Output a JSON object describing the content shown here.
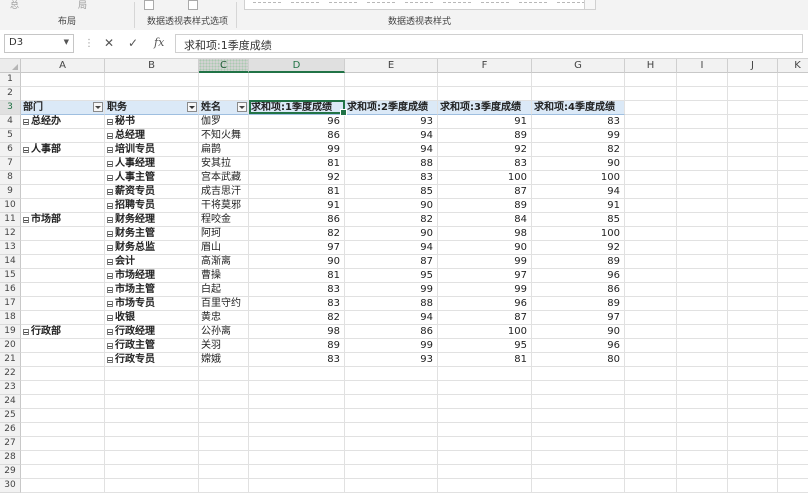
{
  "ribbon": {
    "fragment_left": "总",
    "fragment_mid": "局",
    "group_layout": "布局",
    "group_style_options": "数据透视表样式选项",
    "group_styles": "数据透视表样式"
  },
  "formula_bar": {
    "name_box": "D3",
    "cancel_icon": "✕",
    "confirm_icon": "✓",
    "function_icon": "fx",
    "formula": "求和项:1季度成绩"
  },
  "grid": {
    "selected_cell": "D3",
    "columns": [
      "A",
      "B",
      "C",
      "D",
      "E",
      "F",
      "G",
      "H",
      "I",
      "J",
      "K"
    ],
    "rows": [
      "1",
      "2",
      "3",
      "4",
      "5",
      "6",
      "7",
      "8",
      "9",
      "10",
      "11",
      "12",
      "13",
      "14",
      "15",
      "16",
      "17",
      "18",
      "19",
      "20",
      "21",
      "22",
      "23",
      "24",
      "25",
      "26",
      "27",
      "28",
      "29",
      "30"
    ],
    "header_row": {
      "dept": "部门",
      "job": "职务",
      "name": "姓名",
      "q1": "求和项:1季度成绩",
      "q2": "求和项:2季度成绩",
      "q3": "求和项:3季度成绩",
      "q4": "求和项:4季度成绩"
    },
    "data": [
      {
        "dept": "总经办",
        "job": "秘书",
        "name": "伽罗",
        "q1": "96",
        "q2": "93",
        "q3": "91",
        "q4": "83"
      },
      {
        "dept": "",
        "job": "总经理",
        "name": "不知火舞",
        "q1": "86",
        "q2": "94",
        "q3": "89",
        "q4": "99"
      },
      {
        "dept": "人事部",
        "job": "培训专员",
        "name": "扁鹊",
        "q1": "99",
        "q2": "94",
        "q3": "92",
        "q4": "82"
      },
      {
        "dept": "",
        "job": "人事经理",
        "name": "安其拉",
        "q1": "81",
        "q2": "88",
        "q3": "83",
        "q4": "90"
      },
      {
        "dept": "",
        "job": "人事主管",
        "name": "宫本武藏",
        "q1": "92",
        "q2": "83",
        "q3": "100",
        "q4": "100"
      },
      {
        "dept": "",
        "job": "薪资专员",
        "name": "成吉思汗",
        "q1": "81",
        "q2": "85",
        "q3": "87",
        "q4": "94"
      },
      {
        "dept": "",
        "job": "招聘专员",
        "name": "干将莫邪",
        "q1": "91",
        "q2": "90",
        "q3": "89",
        "q4": "91"
      },
      {
        "dept": "市场部",
        "job": "财务经理",
        "name": "程咬金",
        "q1": "86",
        "q2": "82",
        "q3": "84",
        "q4": "85"
      },
      {
        "dept": "",
        "job": "财务主管",
        "name": "阿珂",
        "q1": "82",
        "q2": "90",
        "q3": "98",
        "q4": "100"
      },
      {
        "dept": "",
        "job": "财务总监",
        "name": "眉山",
        "q1": "97",
        "q2": "94",
        "q3": "90",
        "q4": "92"
      },
      {
        "dept": "",
        "job": "会计",
        "name": "高渐离",
        "q1": "90",
        "q2": "87",
        "q3": "99",
        "q4": "89"
      },
      {
        "dept": "",
        "job": "市场经理",
        "name": "曹操",
        "q1": "81",
        "q2": "95",
        "q3": "97",
        "q4": "96"
      },
      {
        "dept": "",
        "job": "市场主管",
        "name": "白起",
        "q1": "83",
        "q2": "99",
        "q3": "99",
        "q4": "86"
      },
      {
        "dept": "",
        "job": "市场专员",
        "name": "百里守约",
        "q1": "83",
        "q2": "88",
        "q3": "96",
        "q4": "89"
      },
      {
        "dept": "",
        "job": "收银",
        "name": "黄忠",
        "q1": "82",
        "q2": "94",
        "q3": "87",
        "q4": "97"
      },
      {
        "dept": "行政部",
        "job": "行政经理",
        "name": "公孙离",
        "q1": "98",
        "q2": "86",
        "q3": "100",
        "q4": "90"
      },
      {
        "dept": "",
        "job": "行政主管",
        "name": "关羽",
        "q1": "89",
        "q2": "99",
        "q3": "95",
        "q4": "96"
      },
      {
        "dept": "",
        "job": "行政专员",
        "name": "嫦娥",
        "q1": "83",
        "q2": "93",
        "q3": "81",
        "q4": "80"
      }
    ]
  }
}
